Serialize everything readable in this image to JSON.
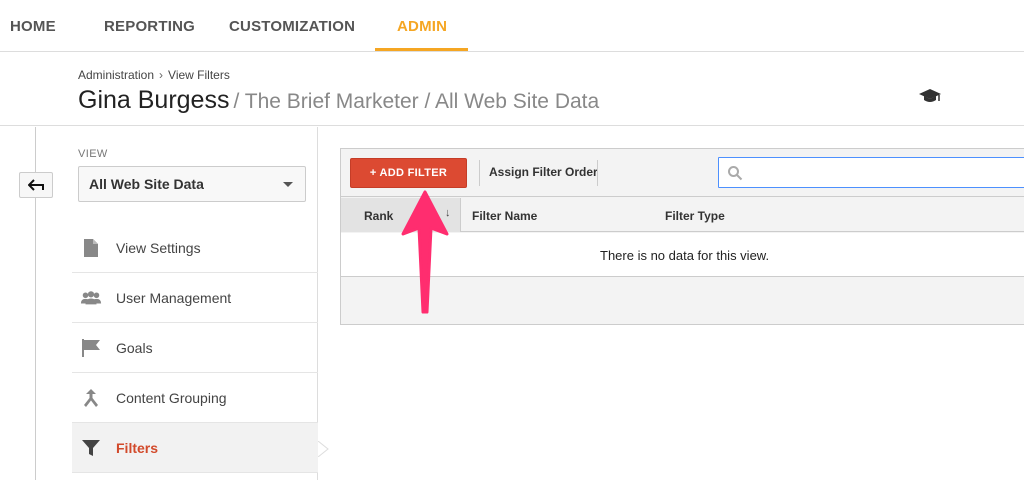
{
  "topnav": {
    "tabs": [
      {
        "label": "HOME"
      },
      {
        "label": "REPORTING"
      },
      {
        "label": "CUSTOMIZATION"
      },
      {
        "label": "ADMIN"
      }
    ],
    "active_color": "#f5a623"
  },
  "header": {
    "breadcrumb": [
      "Administration",
      "View Filters"
    ],
    "breadcrumb_sep": "›",
    "account": "Gina Burgess",
    "path": "/ The Brief Marketer / All Web Site Data",
    "cap_icon": "graduation-cap-icon"
  },
  "sidebar": {
    "back_icon": "back-arrow-icon",
    "view_label": "VIEW",
    "view_value": "All Web Site Data",
    "items": [
      {
        "label": "View Settings",
        "icon": "document-icon"
      },
      {
        "label": "User Management",
        "icon": "people-icon"
      },
      {
        "label": "Goals",
        "icon": "flag-icon"
      },
      {
        "label": "Content Grouping",
        "icon": "content-grouping-icon"
      },
      {
        "label": "Filters",
        "icon": "filter-icon",
        "active": true
      }
    ],
    "active_color": "#d24a2b"
  },
  "toolbar": {
    "add_filter_label": "+ ADD FILTER",
    "assign_order_label": "Assign Filter Order",
    "search_placeholder": "",
    "accent": "#dc4a32"
  },
  "table": {
    "columns": [
      "Rank",
      "Filter Name",
      "Filter Type"
    ],
    "sort_indicator": "↓",
    "empty_message": "There is no data for this view."
  },
  "annotation": {
    "color": "#ff2d6f",
    "icon": "pink-arrow-annotation"
  }
}
